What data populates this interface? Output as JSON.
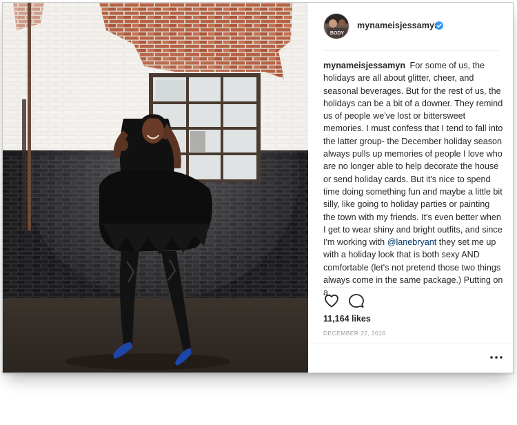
{
  "post": {
    "username": "mynameisjessamyn",
    "avatar_text": "BODY",
    "verified": true,
    "caption": {
      "username": "mynameisjessamyn",
      "text_before": "For some of us, the holidays are all about glitter, cheer, and seasonal beverages. But for the rest of us, the holidays can be a bit of a downer. They remind us of people we've lost or bittersweet memories. I must confess that I tend to fall into the latter group- the December holiday season always pulls up memories of people I love who are no longer able to help decorate the house or send holiday cards. But it's nice to spend time doing something fun and maybe a little bit silly, like going to holiday parties or painting the town with my friends. It's even better when I get to wear shiny and bright outfits, and since I'm working with",
      "mention": "@lanebryant",
      "text_after": "they set me up with a holiday look that is both sexy AND comfortable (let's not pretend those two things always come in the same package.) Putting on a"
    },
    "likes": "11,164 likes",
    "date": "DECEMBER 22, 2016"
  },
  "icons": {
    "like": "heart-icon",
    "comment": "comment-icon",
    "more": "more-options-icon",
    "verified": "verified-badge-icon"
  },
  "colors": {
    "verified_blue": "#3897f0",
    "mention": "#003569",
    "date_gray": "#999999",
    "text": "#262626"
  }
}
